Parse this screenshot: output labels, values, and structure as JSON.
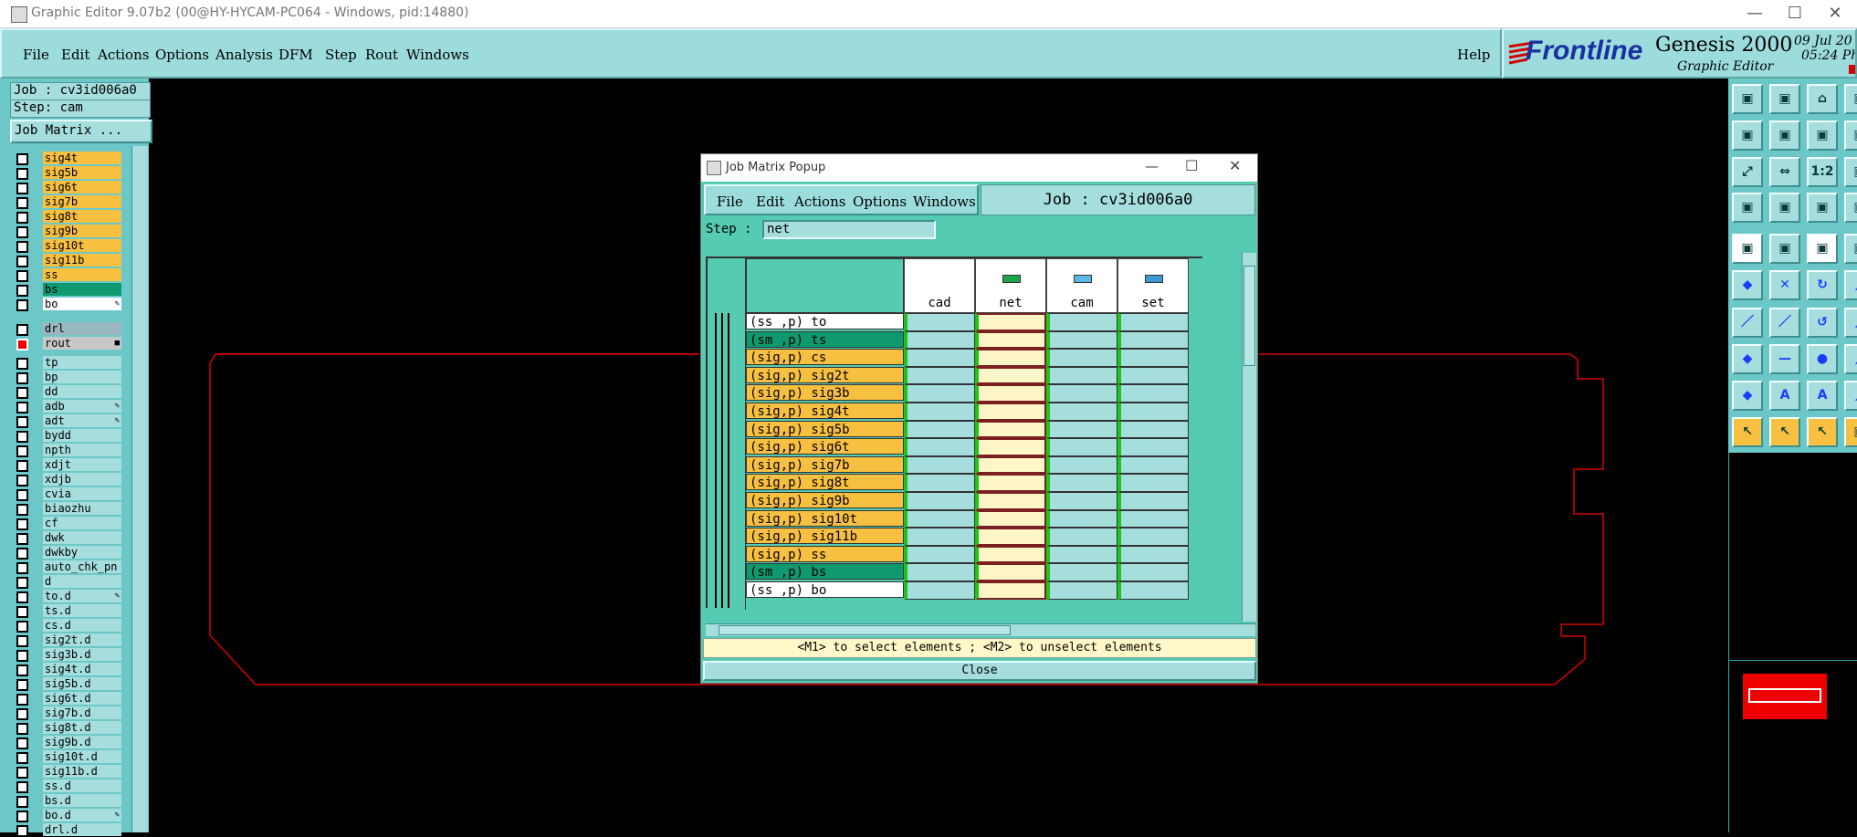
{
  "window": {
    "title": "Graphic Editor 9.07b2 (00@HY-HYCAM-PC064 - Windows, pid:14880)",
    "minimize": "—",
    "maximize": "☐",
    "close": "✕"
  },
  "menubar": {
    "items": [
      "File",
      "Edit",
      "Actions",
      "Options",
      "Analysis",
      "DFM",
      "Step",
      "Rout",
      "Windows"
    ],
    "help": "Help"
  },
  "logo": {
    "brand": "Frontline",
    "product": "Genesis 2000",
    "subtitle": "Graphic Editor",
    "date": "09 Jul 20",
    "time": "05:24 Ph"
  },
  "left_panel": {
    "job": "Job : cv3id006a0",
    "step": "Step: cam",
    "job_matrix_button": "Job Matrix ...",
    "layers_group1": [
      {
        "name": "sig4t",
        "color": "#f8c040"
      },
      {
        "name": "sig5b",
        "color": "#f8c040"
      },
      {
        "name": "sig6t",
        "color": "#f8c040"
      },
      {
        "name": "sig7b",
        "color": "#f8c040"
      },
      {
        "name": "sig8t",
        "color": "#f8c040"
      },
      {
        "name": "sig9b",
        "color": "#f8c040"
      },
      {
        "name": "sig10t",
        "color": "#f8c040"
      },
      {
        "name": "sig11b",
        "color": "#f8c040"
      },
      {
        "name": "ss",
        "color": "#f8c040"
      },
      {
        "name": "bs",
        "color": "#0e9a6e"
      },
      {
        "name": "bo",
        "color": "#ffffff",
        "mark": "✎"
      }
    ],
    "layers_group2": [
      {
        "name": "drl",
        "color": "#9ab6bf"
      },
      {
        "name": "rout",
        "color": "#c8c8c8",
        "mark": "■",
        "checked_red": true
      }
    ],
    "layers_group3": [
      {
        "name": "tp"
      },
      {
        "name": "bp"
      },
      {
        "name": "dd"
      },
      {
        "name": "adb",
        "mark": "✎"
      },
      {
        "name": "adt",
        "mark": "✎"
      },
      {
        "name": "bydd"
      },
      {
        "name": "npth"
      },
      {
        "name": "xdjt"
      },
      {
        "name": "xdjb"
      },
      {
        "name": "cvia"
      },
      {
        "name": "biaozhu"
      },
      {
        "name": "cf"
      },
      {
        "name": "dwk"
      },
      {
        "name": "dwkby"
      },
      {
        "name": "auto_chk_pn"
      },
      {
        "name": "d"
      },
      {
        "name": "to.d",
        "mark": "✎"
      },
      {
        "name": "ts.d"
      },
      {
        "name": "cs.d"
      },
      {
        "name": "sig2t.d"
      },
      {
        "name": "sig3b.d"
      },
      {
        "name": "sig4t.d"
      },
      {
        "name": "sig5b.d"
      },
      {
        "name": "sig6t.d"
      },
      {
        "name": "sig7b.d"
      },
      {
        "name": "sig8t.d"
      },
      {
        "name": "sig9b.d"
      },
      {
        "name": "sig10t.d"
      },
      {
        "name": "sig11b.d"
      },
      {
        "name": "ss.d"
      },
      {
        "name": "bs.d"
      },
      {
        "name": "bo.d",
        "mark": "✎"
      },
      {
        "name": "drl.d"
      }
    ]
  },
  "popup": {
    "title": "Job Matrix Popup",
    "menu": [
      "File",
      "Edit",
      "Actions",
      "Options",
      "Windows"
    ],
    "job_label": "Job : cv3id006a0",
    "step_label": "Step :",
    "step_value": "net",
    "columns": [
      "cad",
      "net",
      "cam",
      "set"
    ],
    "rows": [
      {
        "label": "(ss ,p) to",
        "color": "#ffffff"
      },
      {
        "label": "(sm ,p) ts",
        "color": "#0e9a6e"
      },
      {
        "label": "(sig,p) cs",
        "color": "#f8c040"
      },
      {
        "label": "(sig,p) sig2t",
        "color": "#f8c040"
      },
      {
        "label": "(sig,p) sig3b",
        "color": "#f8c040"
      },
      {
        "label": "(sig,p) sig4t",
        "color": "#f8c040"
      },
      {
        "label": "(sig,p) sig5b",
        "color": "#f8c040"
      },
      {
        "label": "(sig,p) sig6t",
        "color": "#f8c040"
      },
      {
        "label": "(sig,p) sig7b",
        "color": "#f8c040"
      },
      {
        "label": "(sig,p) sig8t",
        "color": "#f8c040"
      },
      {
        "label": "(sig,p) sig9b",
        "color": "#f8c040"
      },
      {
        "label": "(sig,p) sig10t",
        "color": "#f8c040"
      },
      {
        "label": "(sig,p) sig11b",
        "color": "#f8c040"
      },
      {
        "label": "(sig,p) ss",
        "color": "#f8c040"
      },
      {
        "label": "(sm ,p) bs",
        "color": "#0e9a6e"
      },
      {
        "label": "(ss ,p) bo",
        "color": "#ffffff"
      }
    ],
    "hint": "<M1> to select elements ; <M2> to unselect elements",
    "close_button": "Close"
  },
  "colors": {
    "panel": "#6cc8c8",
    "panel_light": "#a6dede",
    "signal": "#f8c040",
    "mask": "#0e9a6e",
    "outline": "#d40000",
    "net_column": "#fff6c8"
  }
}
